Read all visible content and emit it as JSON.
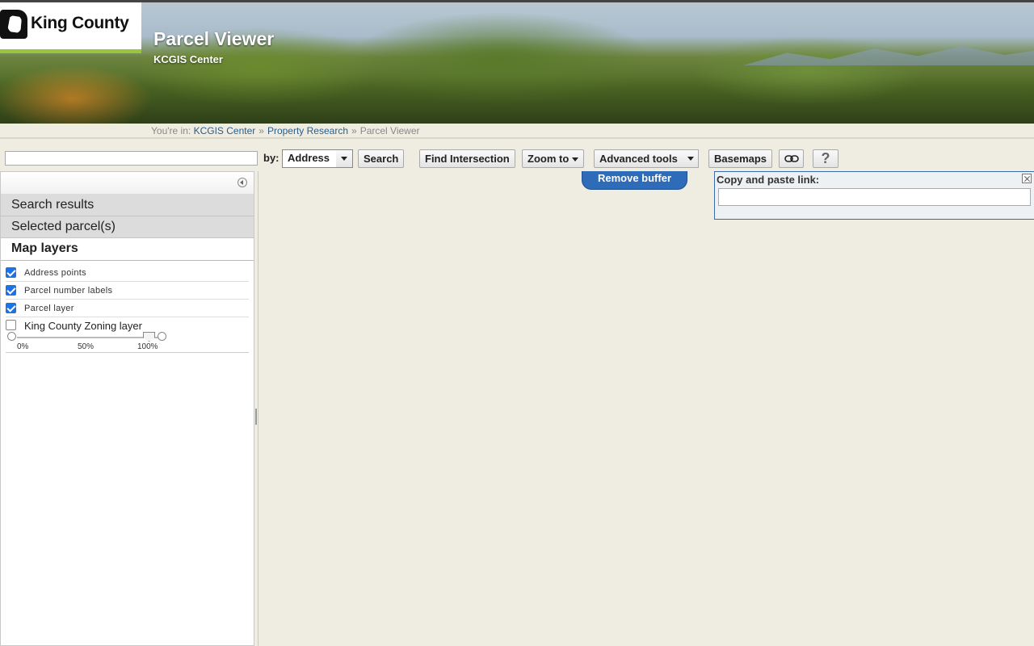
{
  "header": {
    "logo_text": "King County",
    "app_title": "Parcel Viewer",
    "app_subtitle": "KCGIS Center"
  },
  "breadcrumb": {
    "prefix": "You're in:",
    "items": [
      "KCGIS Center",
      "Property Research"
    ],
    "current": "Parcel Viewer",
    "separator": "»"
  },
  "toolbar": {
    "search_value": "",
    "by_label": "by:",
    "by_selected": "Address",
    "search_button": "Search",
    "find_intersection_button": "Find Intersection",
    "zoom_to_button": "Zoom to",
    "advanced_tools_button": "Advanced tools",
    "basemaps_button": "Basemaps",
    "help_button": "?"
  },
  "left_panel": {
    "sections": [
      "Search results",
      "Selected parcel(s)",
      "Map layers"
    ],
    "layers": [
      {
        "label": "Address points",
        "checked": true
      },
      {
        "label": "Parcel number labels",
        "checked": true
      },
      {
        "label": "Parcel layer",
        "checked": true
      },
      {
        "label": "King County Zoning layer",
        "checked": false
      }
    ],
    "opacity_ticks": [
      "0%",
      "50%",
      "100%"
    ],
    "opacity_value": 1.0
  },
  "map": {
    "remove_buffer_button": "Remove buffer",
    "link_panel": {
      "label": "Copy and paste link:",
      "value": ""
    }
  },
  "colors": {
    "accent_green": "#9bc53d",
    "link_blue": "#2a5d8a",
    "buffer_button": "#2e6bb8",
    "checkbox_on": "#1a73e8"
  }
}
